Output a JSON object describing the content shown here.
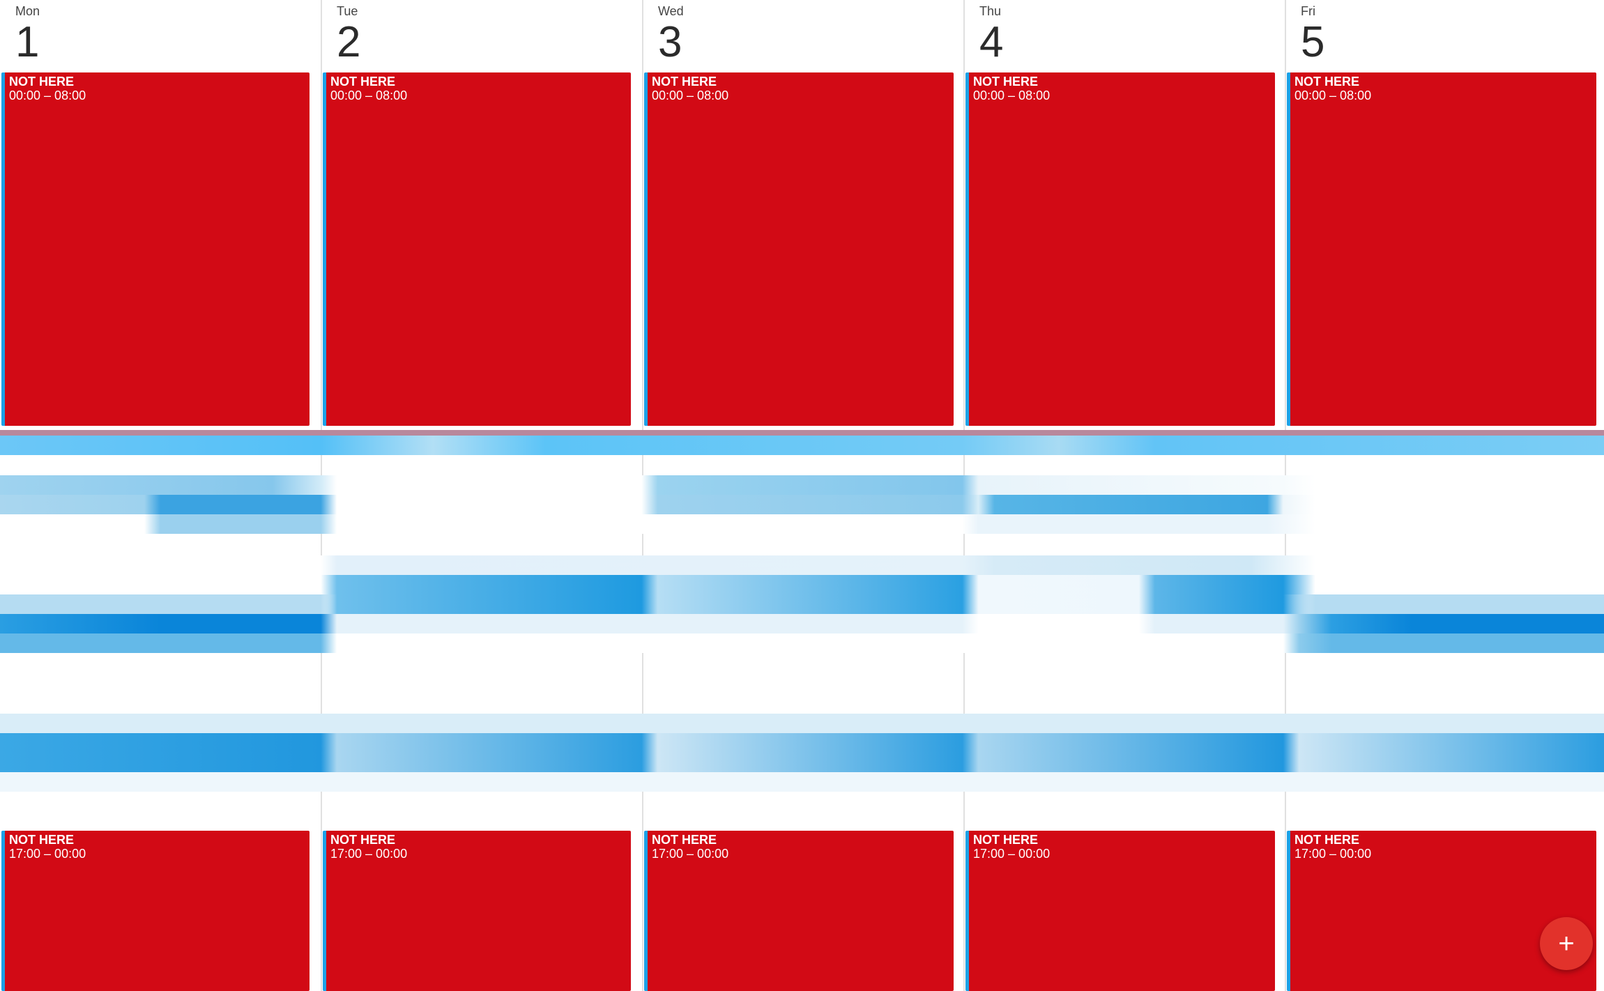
{
  "days": [
    {
      "dow": "Mon",
      "num": "1"
    },
    {
      "dow": "Tue",
      "num": "2"
    },
    {
      "dow": "Wed",
      "num": "3"
    },
    {
      "dow": "Thu",
      "num": "4"
    },
    {
      "dow": "Fri",
      "num": "5"
    }
  ],
  "events": {
    "morning": {
      "title": "NOT HERE",
      "time": "00:00 – 08:00"
    },
    "evening": {
      "title": "NOT HERE",
      "time": "17:00 – 00:00"
    }
  },
  "colors": {
    "event_red": "#d20a15",
    "event_accent": "#1da1e6",
    "fab": "#e2322b",
    "blurred_event_blue": "#1a8fe0"
  },
  "fab": {
    "icon": "plus-icon",
    "glyph": "+"
  }
}
